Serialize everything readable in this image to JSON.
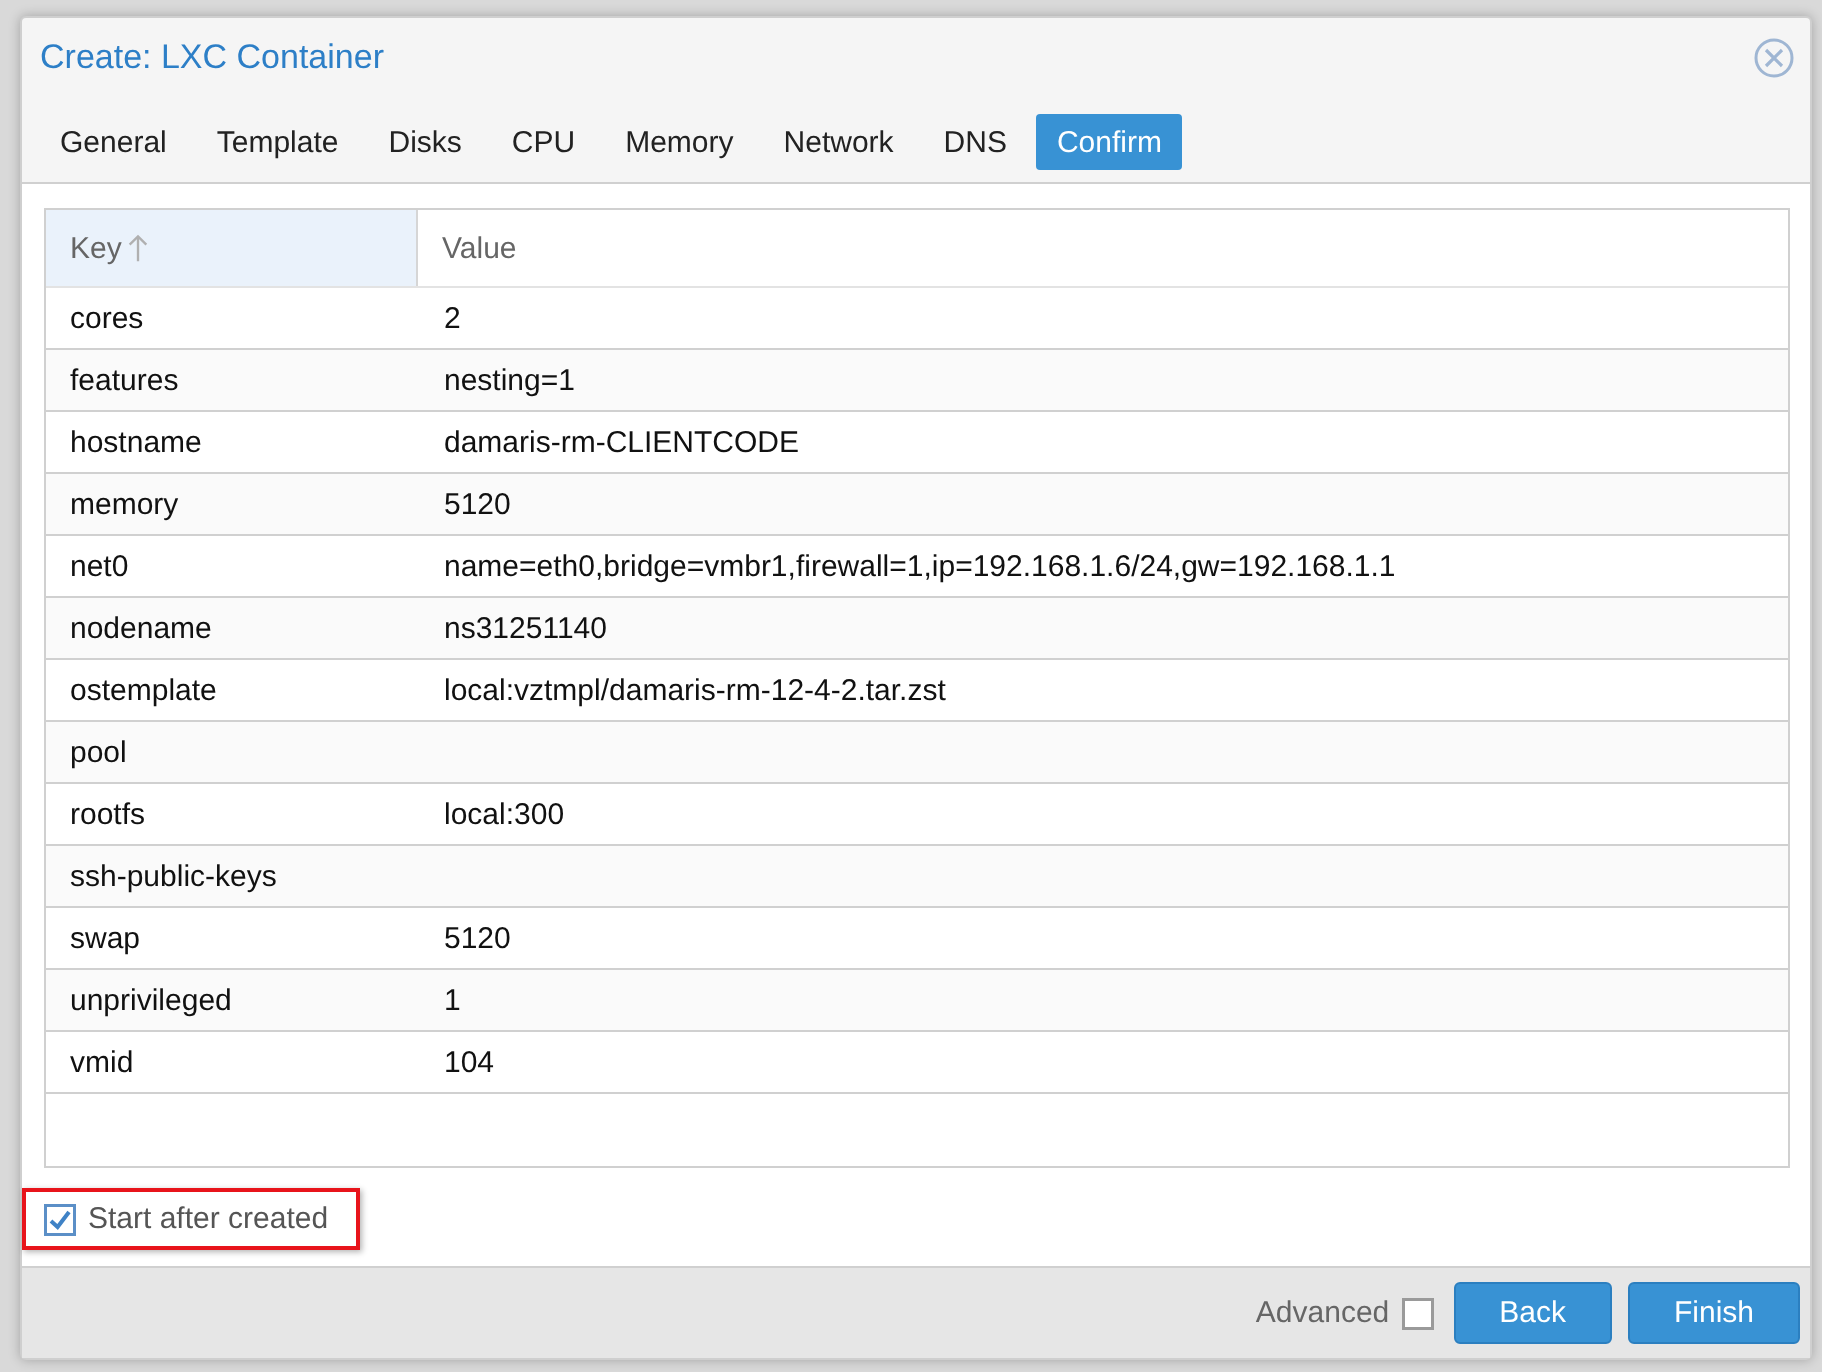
{
  "window": {
    "title": "Create: LXC Container"
  },
  "tabs": [
    {
      "label": "General",
      "selected": false
    },
    {
      "label": "Template",
      "selected": false
    },
    {
      "label": "Disks",
      "selected": false
    },
    {
      "label": "CPU",
      "selected": false
    },
    {
      "label": "Memory",
      "selected": false
    },
    {
      "label": "Network",
      "selected": false
    },
    {
      "label": "DNS",
      "selected": false
    },
    {
      "label": "Confirm",
      "selected": true
    }
  ],
  "table": {
    "columns": [
      {
        "label": "Key",
        "sorted": true
      },
      {
        "label": "Value",
        "sorted": false
      }
    ],
    "rows": [
      {
        "key": "cores",
        "value": "2"
      },
      {
        "key": "features",
        "value": "nesting=1"
      },
      {
        "key": "hostname",
        "value": "damaris-rm-CLIENTCODE"
      },
      {
        "key": "memory",
        "value": "5120"
      },
      {
        "key": "net0",
        "value": "name=eth0,bridge=vmbr1,firewall=1,ip=192.168.1.6/24,gw=192.168.1.1"
      },
      {
        "key": "nodename",
        "value": "ns31251140"
      },
      {
        "key": "ostemplate",
        "value": "local:vztmpl/damaris-rm-12-4-2.tar.zst"
      },
      {
        "key": "pool",
        "value": ""
      },
      {
        "key": "rootfs",
        "value": "local:300"
      },
      {
        "key": "ssh-public-keys",
        "value": ""
      },
      {
        "key": "swap",
        "value": "5120"
      },
      {
        "key": "unprivileged",
        "value": "1"
      },
      {
        "key": "vmid",
        "value": "104"
      }
    ]
  },
  "start_after_created": {
    "label": "Start after created",
    "checked": true,
    "highlighted": true
  },
  "footer": {
    "advanced": {
      "label": "Advanced",
      "checked": false
    },
    "buttons": [
      "Back",
      "Finish"
    ]
  }
}
